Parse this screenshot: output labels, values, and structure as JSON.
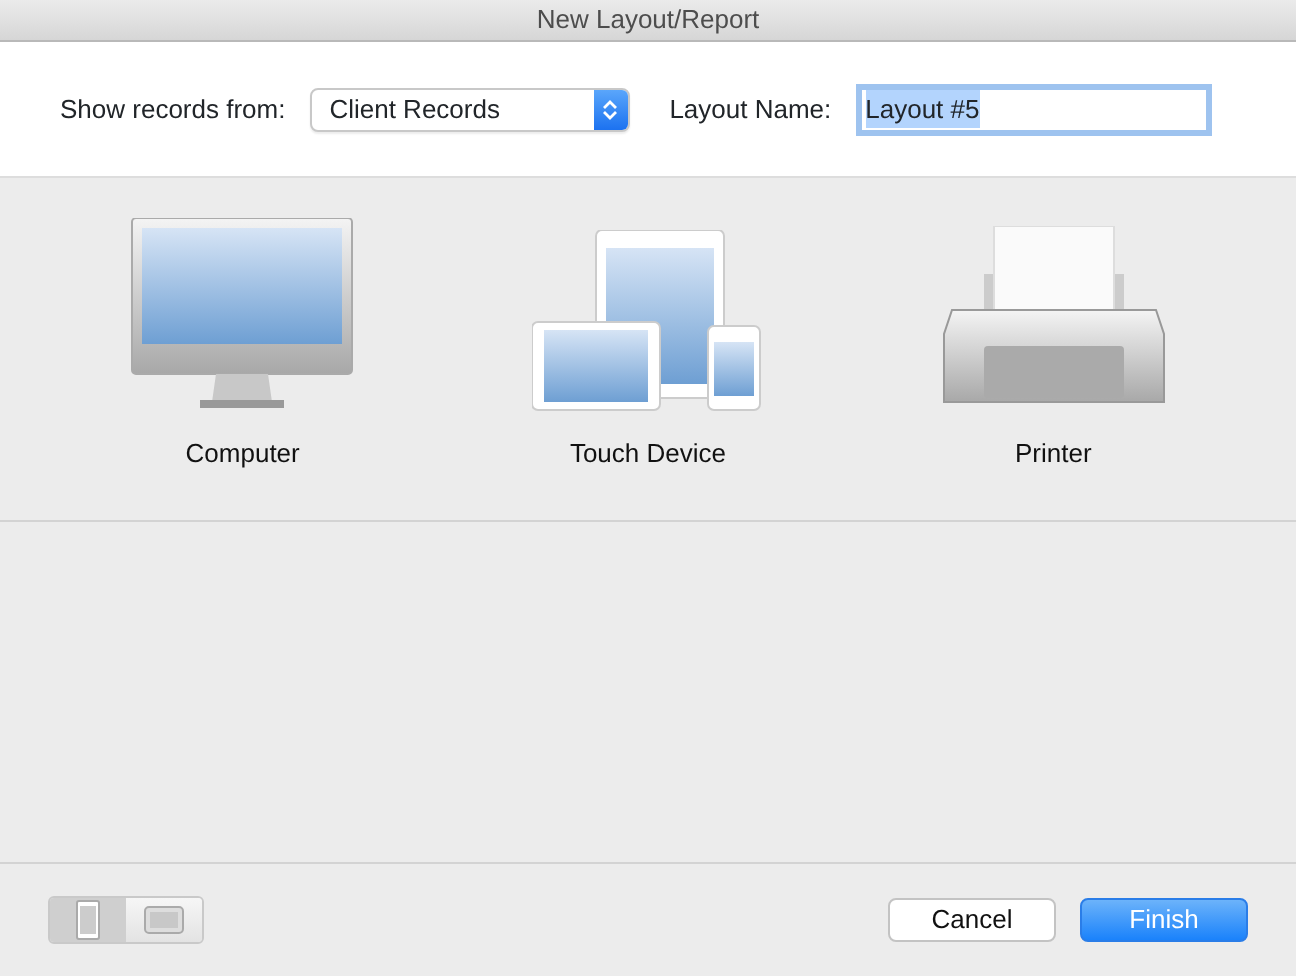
{
  "window": {
    "title": "New Layout/Report"
  },
  "source": {
    "label": "Show records from:",
    "value": "Client Records"
  },
  "layout_name": {
    "label": "Layout Name:",
    "value": "Layout #5",
    "highlighted": true
  },
  "devices": [
    {
      "kind": "computer",
      "label": "Computer",
      "selected": false
    },
    {
      "kind": "touch",
      "label": "Touch Device",
      "selected": false
    },
    {
      "kind": "printer",
      "label": "Printer",
      "selected": false
    }
  ],
  "orientation": [
    {
      "kind": "portrait",
      "selected": true
    },
    {
      "kind": "landscape",
      "selected": false
    }
  ],
  "buttons": [
    {
      "label": "Cancel",
      "kind": "secondary"
    },
    {
      "label": "Finish",
      "kind": "primary"
    }
  ]
}
